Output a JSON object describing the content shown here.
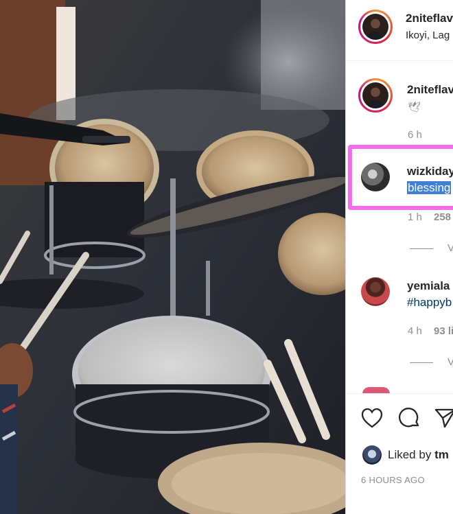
{
  "photo": {
    "alt": "drum kit"
  },
  "post_header": {
    "username": "2niteflav",
    "location": "Ikoyi, Lag"
  },
  "caption": {
    "username": "2niteflav",
    "text": "🕊",
    "time": "6 h"
  },
  "comments": [
    {
      "username": "wizkiday",
      "text": "blessing",
      "time": "1 h",
      "likes": "258",
      "reply_label": "V",
      "selected": true
    },
    {
      "username": "yemiala",
      "text": "#happyb",
      "time": "4 h",
      "likes": "93 li",
      "reply_label": "V"
    }
  ],
  "actions": {
    "like": "heart-icon",
    "comment": "comment-icon",
    "share": "share-icon"
  },
  "likes": {
    "prefix": "Liked by",
    "name": "tm"
  },
  "timestamp": "6 HOURS AGO",
  "colors": {
    "highlight": "#f56cf0",
    "selection": "#3f7fd6",
    "hashtag": "#00376b"
  }
}
